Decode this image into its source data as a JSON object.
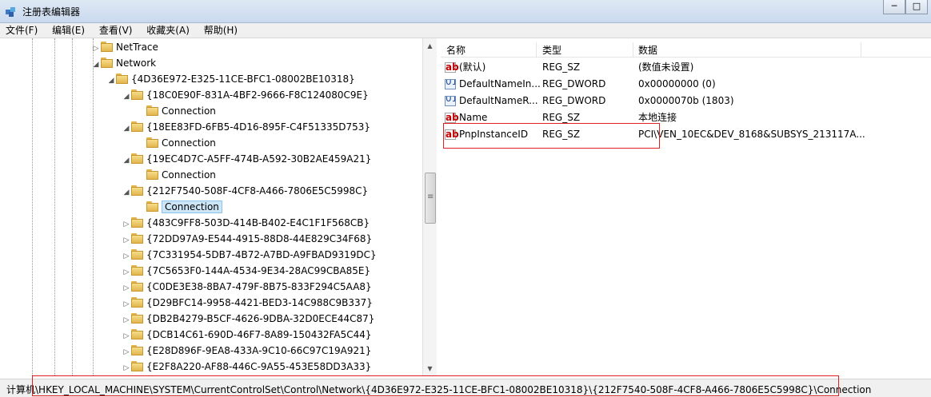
{
  "window": {
    "title": "注册表编辑器",
    "buttons": [
      "─",
      "□"
    ]
  },
  "menu": [
    "文件(F)",
    "编辑(E)",
    "查看(V)",
    "收藏夹(A)",
    "帮助(H)"
  ],
  "tree": [
    {
      "label": "NetTrace",
      "expander": "▷"
    },
    {
      "label": "Network",
      "expander": "◢"
    },
    {
      "label": "{4D36E972-E325-11CE-BFC1-08002BE10318}",
      "expander": "◢"
    },
    {
      "label": "{18C0E90F-831A-4BF2-9666-F8C124080C9E}",
      "expander": "◢"
    },
    {
      "label": "Connection",
      "expander": ""
    },
    {
      "label": "{18EE83FD-6FB5-4D16-895F-C4F51335D753}",
      "expander": "◢"
    },
    {
      "label": "Connection",
      "expander": ""
    },
    {
      "label": "{19EC4D7C-A5FF-474B-A592-30B2AE459A21}",
      "expander": "◢"
    },
    {
      "label": "Connection",
      "expander": ""
    },
    {
      "label": "{212F7540-508F-4CF8-A466-7806E5C5998C}",
      "expander": "◢"
    },
    {
      "label": "Connection",
      "expander": ""
    },
    {
      "label": "{483C9FF8-503D-414B-B402-E4C1F1F568CB}",
      "expander": "▷"
    },
    {
      "label": "{72DD97A9-E544-4915-88D8-44E829C34F68}",
      "expander": "▷"
    },
    {
      "label": "{7C331954-5DB7-4B72-A7BD-A9FBAD9319DC}",
      "expander": "▷"
    },
    {
      "label": "{7C5653F0-144A-4534-9E34-28AC99CBA85E}",
      "expander": "▷"
    },
    {
      "label": "{C0DE3E38-8BA7-479F-8B75-833F294C5AA8}",
      "expander": "▷"
    },
    {
      "label": "{D29BFC14-9958-4421-BED3-14C988C9B337}",
      "expander": "▷"
    },
    {
      "label": "{DB2B4279-B5CF-4626-9DBA-32D0ECE44C87}",
      "expander": "▷"
    },
    {
      "label": "{DCB14C61-690D-46F7-8A89-150432FA5C44}",
      "expander": "▷"
    },
    {
      "label": "{E28D896F-9EA8-433A-9C10-66C97C19A921}",
      "expander": "▷"
    },
    {
      "label": "{E2F8A220-AF88-446C-9A55-453E58DD3A33}",
      "expander": "▷"
    }
  ],
  "values": {
    "headers": {
      "name": "名称",
      "type": "类型",
      "data": "数据"
    },
    "rows": [
      {
        "icon": "string-value-icon",
        "icon_text": "ab",
        "name": "(默认)",
        "type": "REG_SZ",
        "data": "(数值未设置)"
      },
      {
        "icon": "dword-value-icon",
        "icon_text": "011 110",
        "name": "DefaultNameIn...",
        "type": "REG_DWORD",
        "data": "0x00000000 (0)"
      },
      {
        "icon": "dword-value-icon",
        "icon_text": "011 110",
        "name": "DefaultNameR...",
        "type": "REG_DWORD",
        "data": "0x0000070b (1803)"
      },
      {
        "icon": "string-value-icon",
        "icon_text": "ab",
        "name": "Name",
        "type": "REG_SZ",
        "data": "本地连接"
      },
      {
        "icon": "string-value-icon",
        "icon_text": "ab",
        "name": "PnpInstanceID",
        "type": "REG_SZ",
        "data": "PCI\\VEN_10EC&DEV_8168&SUBSYS_213117A..."
      }
    ]
  },
  "status": {
    "path": "计算机\\HKEY_LOCAL_MACHINE\\SYSTEM\\CurrentControlSet\\Control\\Network\\{4D36E972-E325-11CE-BFC1-08002BE10318}\\{212F7540-508F-4CF8-A466-7806E5C5998C}\\Connection"
  },
  "scroll_icons": {
    "up": "▲",
    "down": "▼",
    "grip": "≡"
  },
  "colors": {
    "highlight_box": "#e02020",
    "selection": "#cde6f7"
  }
}
